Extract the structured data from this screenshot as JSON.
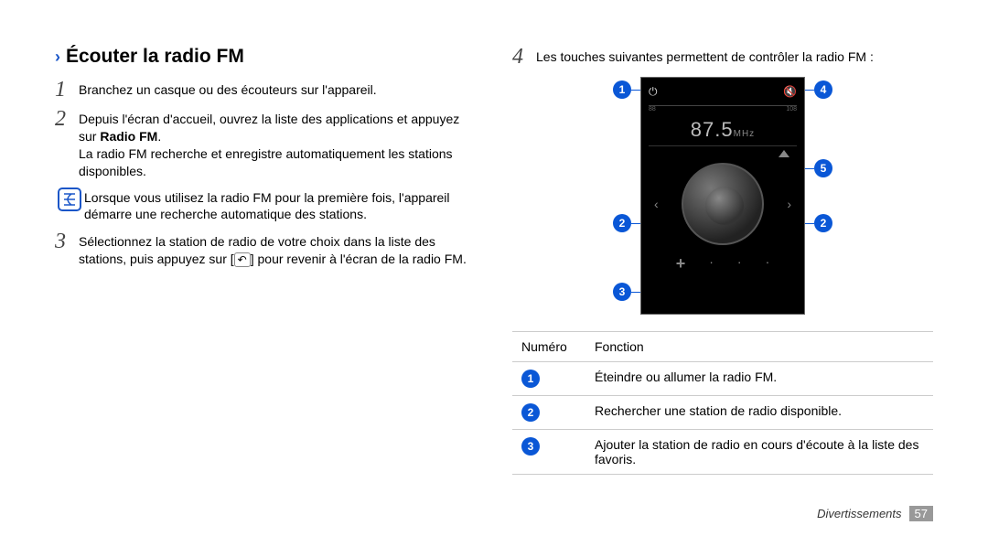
{
  "heading": "Écouter la radio FM",
  "steps_left": [
    {
      "num": "1",
      "text": "Branchez un casque ou des écouteurs sur l'appareil."
    },
    {
      "num": "2",
      "text": "Depuis l'écran d'accueil, ouvrez la liste des applications et appuyez sur ",
      "bold": "Radio FM",
      "tail": "."
    },
    {
      "num": "",
      "text": "La radio FM recherche et enregistre automatiquement les stations disponibles."
    }
  ],
  "note": "Lorsque vous utilisez la radio FM pour la première fois, l'appareil démarre une recherche automatique des stations.",
  "step3": {
    "num": "3",
    "text_a": "Sélectionnez la station de radio de votre choix dans la liste des stations, puis appuyez sur [",
    "text_b": "] pour revenir à l'écran de la radio FM."
  },
  "back_glyph": "↶",
  "step4": {
    "num": "4",
    "text": "Les touches suivantes permettent de contrôler la radio FM :"
  },
  "radio": {
    "power_glyph": "⏻",
    "mute_glyph": "🔇",
    "scale_min": "88",
    "scale_max": "108",
    "freq_value": "87.5",
    "freq_unit": "MHz",
    "prev_glyph": "‹",
    "next_glyph": "›",
    "fav_plus": "+"
  },
  "callouts": {
    "c1": "1",
    "c2": "2",
    "c3": "3",
    "c4": "4",
    "c5": "5"
  },
  "table": {
    "hdr_num": "Numéro",
    "hdr_func": "Fonction",
    "rows": [
      {
        "n": "1",
        "f": "Éteindre ou allumer la radio FM."
      },
      {
        "n": "2",
        "f": "Rechercher une station de radio disponible."
      },
      {
        "n": "3",
        "f": "Ajouter la station de radio en cours d'écoute à la liste des favoris."
      }
    ]
  },
  "footer_section": "Divertissements",
  "footer_page": "57",
  "chart_data": {
    "type": "table",
    "title": "FM radio control key reference",
    "columns": [
      "Numéro",
      "Fonction"
    ],
    "rows": [
      [
        "1",
        "Éteindre ou allumer la radio FM."
      ],
      [
        "2",
        "Rechercher une station de radio disponible."
      ],
      [
        "3",
        "Ajouter la station de radio en cours d'écoute à la liste des favoris."
      ]
    ]
  }
}
